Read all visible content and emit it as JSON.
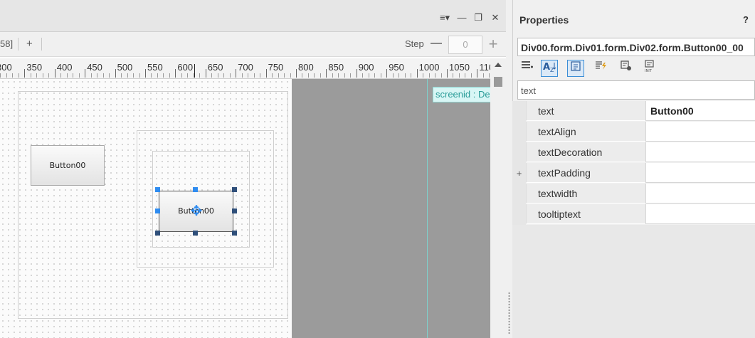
{
  "window_controls": {
    "menu": "≡▾",
    "minimize": "—",
    "restore": "❐",
    "close": "✕"
  },
  "toolbar": {
    "partial_label": "58]",
    "add": "+",
    "step_label": "Step",
    "step_minus": "—",
    "step_value": "0",
    "step_plus": "+"
  },
  "ruler": {
    "ticks": [
      "300",
      "350",
      "400",
      "450",
      "500",
      "550",
      "600",
      "650",
      "700",
      "750",
      "800",
      "850",
      "900",
      "950",
      "1000",
      "1050",
      "110"
    ]
  },
  "canvas": {
    "screenid_label": "screenid : De",
    "button_outer": "Button00",
    "button_selected": "Button00"
  },
  "properties": {
    "title": "Properties",
    "help": "?",
    "path": "Div00.form.Div01.form.Div02.form.Button00_00",
    "filter": "text",
    "toolbar_icons": [
      "list-add-icon",
      "sort-alpha-icon",
      "category-icon",
      "event-icon",
      "style-icon",
      "init-icon"
    ],
    "rows": [
      {
        "gutter": "",
        "name": "text",
        "value": "Button00"
      },
      {
        "gutter": "",
        "name": "textAlign",
        "value": ""
      },
      {
        "gutter": "",
        "name": "textDecoration",
        "value": ""
      },
      {
        "gutter": "+",
        "name": "textPadding",
        "value": ""
      },
      {
        "gutter": "",
        "name": "textwidth",
        "value": ""
      },
      {
        "gutter": "",
        "name": "tooltiptext",
        "value": ""
      }
    ]
  },
  "colors": {
    "selection": "#2f8cf0",
    "guide": "#7fd1cc",
    "screenid_bg": "#d8f6f5",
    "outside_canvas": "#9b9b9b"
  }
}
